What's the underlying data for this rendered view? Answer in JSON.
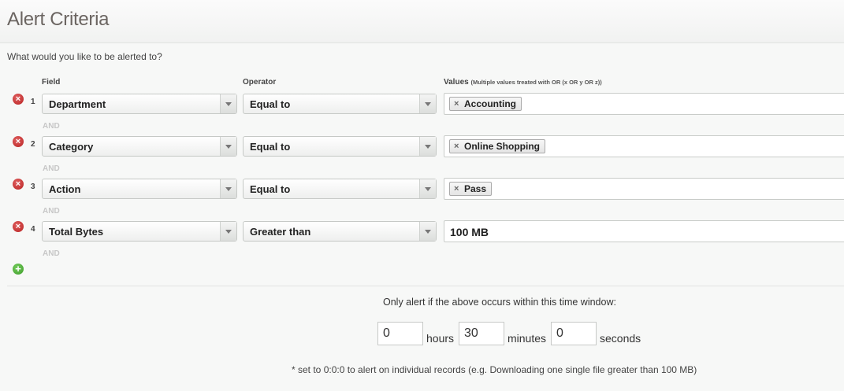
{
  "header": {
    "title": "Alert Criteria"
  },
  "intro": "What would you like to be alerted to?",
  "columns": {
    "field": "Field",
    "operator": "Operator",
    "values": "Values",
    "values_note": "(Multiple values treated with OR (x OR y OR z))"
  },
  "rows": [
    {
      "num": "1",
      "field": "Department",
      "operator": "Equal to",
      "value": "Accounting",
      "value_is_tag": true
    },
    {
      "num": "2",
      "field": "Category",
      "operator": "Equal to",
      "value": "Online Shopping",
      "value_is_tag": true
    },
    {
      "num": "3",
      "field": "Action",
      "operator": "Equal to",
      "value": "Pass",
      "value_is_tag": true
    },
    {
      "num": "4",
      "field": "Total Bytes",
      "operator": "Greater than",
      "value": "100 MB",
      "value_is_tag": false
    }
  ],
  "and_label": "AND",
  "icons": {
    "remove": "remove-circle-icon",
    "add": "add-circle-icon",
    "tag_remove_glyph": "×",
    "remove_glyph": "×",
    "add_glyph": "+"
  },
  "time_window": {
    "label": "Only alert if the above occurs within this time window:",
    "hours": "0",
    "hours_label": "hours",
    "minutes": "30",
    "minutes_label": "minutes",
    "seconds": "0",
    "seconds_label": "seconds"
  },
  "footnote": "* set to 0:0:0 to alert on individual records (e.g. Downloading one single file greater than 100 MB)",
  "colors": {
    "remove": "#c0392b",
    "add": "#4caf3a",
    "and": "#c7c7c7",
    "title": "#6b6561"
  }
}
